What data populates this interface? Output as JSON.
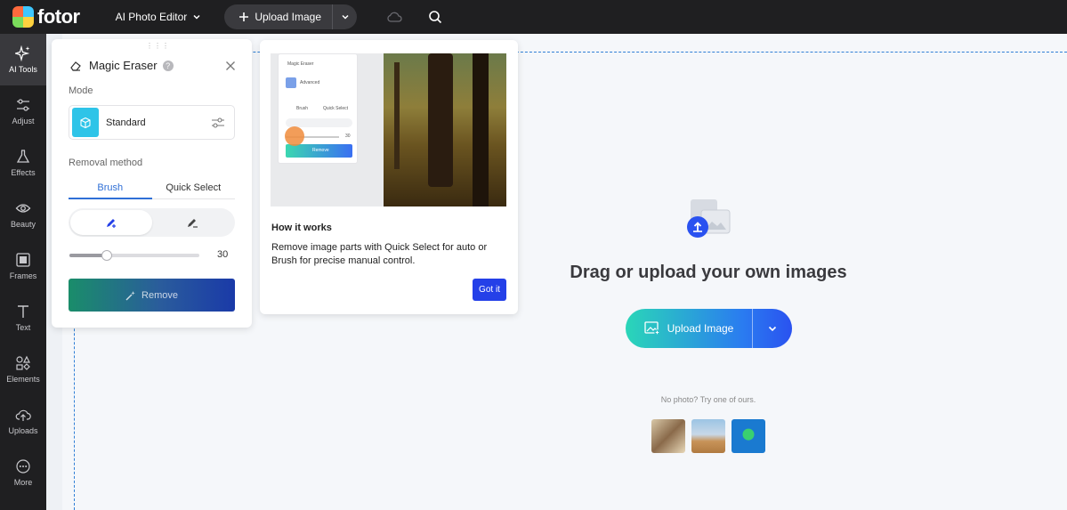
{
  "app": {
    "logo_text": "fotor",
    "menu_label": "AI Photo Editor",
    "upload_label": "Upload Image"
  },
  "sidebar": {
    "items": [
      {
        "label": "AI Tools",
        "icon": "sparkle-icon",
        "active": true
      },
      {
        "label": "Adjust",
        "icon": "sliders-icon"
      },
      {
        "label": "Effects",
        "icon": "flask-icon"
      },
      {
        "label": "Beauty",
        "icon": "eye-icon"
      },
      {
        "label": "Frames",
        "icon": "frame-icon"
      },
      {
        "label": "Text",
        "icon": "text-icon"
      },
      {
        "label": "Elements",
        "icon": "shapes-icon"
      },
      {
        "label": "Uploads",
        "icon": "cloud-upload-icon"
      },
      {
        "label": "More",
        "icon": "more-icon"
      }
    ]
  },
  "panel": {
    "title": "Magic Eraser",
    "mode_label": "Mode",
    "mode_value": "Standard",
    "removal_label": "Removal method",
    "tabs": [
      "Brush",
      "Quick Select"
    ],
    "active_tab": 0,
    "brush_size": "30",
    "brush_size_fraction": 0.29,
    "remove_label": "Remove"
  },
  "howto": {
    "title": "How it works",
    "description": "Remove image parts with Quick Select for auto or Brush for precise manual control.",
    "button": "Got it",
    "mini": {
      "title": "Magic Eraser",
      "mode": "Advanced",
      "tab1": "Brush",
      "tab2": "Quick Select",
      "value": "30",
      "remove": "Remove"
    }
  },
  "upload": {
    "heading": "Drag or upload your own images",
    "button": "Upload Image",
    "no_photo": "No photo? Try one of ours."
  },
  "colors": {
    "topbar": "#1f1f21",
    "accent_blue": "#2440e8",
    "tab_active": "#2f6fd6"
  }
}
